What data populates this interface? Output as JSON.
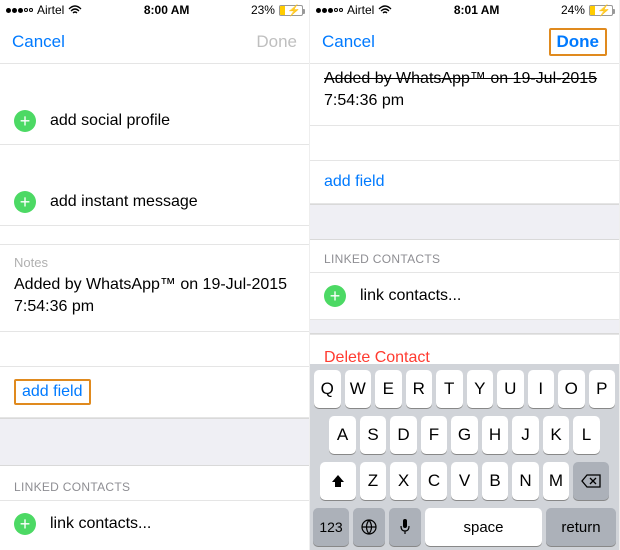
{
  "left": {
    "status": {
      "carrier": "Airtel",
      "time": "8:00 AM",
      "battery_pct": "23%",
      "battery_fill": "23%"
    },
    "nav": {
      "cancel": "Cancel",
      "done": "Done"
    },
    "rows": {
      "social": "add social profile",
      "im": "add instant message",
      "notes_label": "Notes",
      "notes_text": "Added by WhatsApp™ on 19-Jul-2015 7:54:36 pm",
      "add_field": "add field",
      "linked_header": "LINKED CONTACTS",
      "link_contacts": "link contacts..."
    }
  },
  "right": {
    "status": {
      "carrier": "Airtel",
      "time": "8:01 AM",
      "battery_pct": "24%",
      "battery_fill": "24%"
    },
    "nav": {
      "cancel": "Cancel",
      "done": "Done"
    },
    "rows": {
      "clipped_line1": "Added by WhatsApp™ on 19-Jul-2015",
      "clipped_line2": "7:54:36 pm",
      "add_field": "add field",
      "linked_header": "LINKED CONTACTS",
      "link_contacts": "link contacts...",
      "delete": "Delete Contact"
    },
    "keyboard": {
      "r1": [
        "Q",
        "W",
        "E",
        "R",
        "T",
        "Y",
        "U",
        "I",
        "O",
        "P"
      ],
      "r2": [
        "A",
        "S",
        "D",
        "F",
        "G",
        "H",
        "J",
        "K",
        "L"
      ],
      "r3": [
        "Z",
        "X",
        "C",
        "V",
        "B",
        "N",
        "M"
      ],
      "num": "123",
      "space": "space",
      "ret": "return"
    }
  }
}
